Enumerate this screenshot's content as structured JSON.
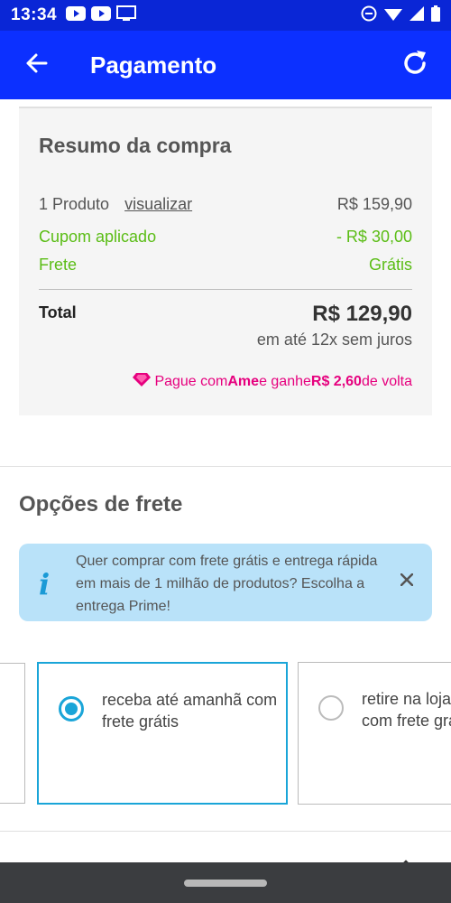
{
  "status_bar": {
    "time": "13:34"
  },
  "app_bar": {
    "title": "Pagamento"
  },
  "summary": {
    "title": "Resumo da compra",
    "products_label": "1 Produto",
    "view_link": "visualizar",
    "products_value": "R$ 159,90",
    "coupon_label": "Cupom aplicado",
    "coupon_value": "- R$ 30,00",
    "shipping_label": "Frete",
    "shipping_value": "Grátis",
    "total_label": "Total",
    "total_value": "R$ 129,90",
    "installments": "em até 12x sem juros",
    "ame_prefix": "Pague com ",
    "ame_brand": "Ame",
    "ame_middle": " e ganhe ",
    "ame_amount": "R$ 2,60",
    "ame_suffix": " de volta"
  },
  "shipping": {
    "title": "Opções de frete",
    "info_icon_glyph": "i",
    "info_text": "Quer comprar com frete grátis e entrega rápida em mais de 1 milhão de produtos? Escolha a entrega Prime!",
    "options": [
      {
        "label": "receba até amanhã com frete grátis",
        "selected": true
      },
      {
        "label": "retire na loja amanhã com frete grátis",
        "selected": false
      }
    ]
  },
  "colors": {
    "app_bar": "#0c30ff",
    "accent_green": "#5bbd16",
    "ame_pink": "#e6007e",
    "info_bg": "#b9e2f9",
    "selected_blue": "#1aa5d8"
  }
}
